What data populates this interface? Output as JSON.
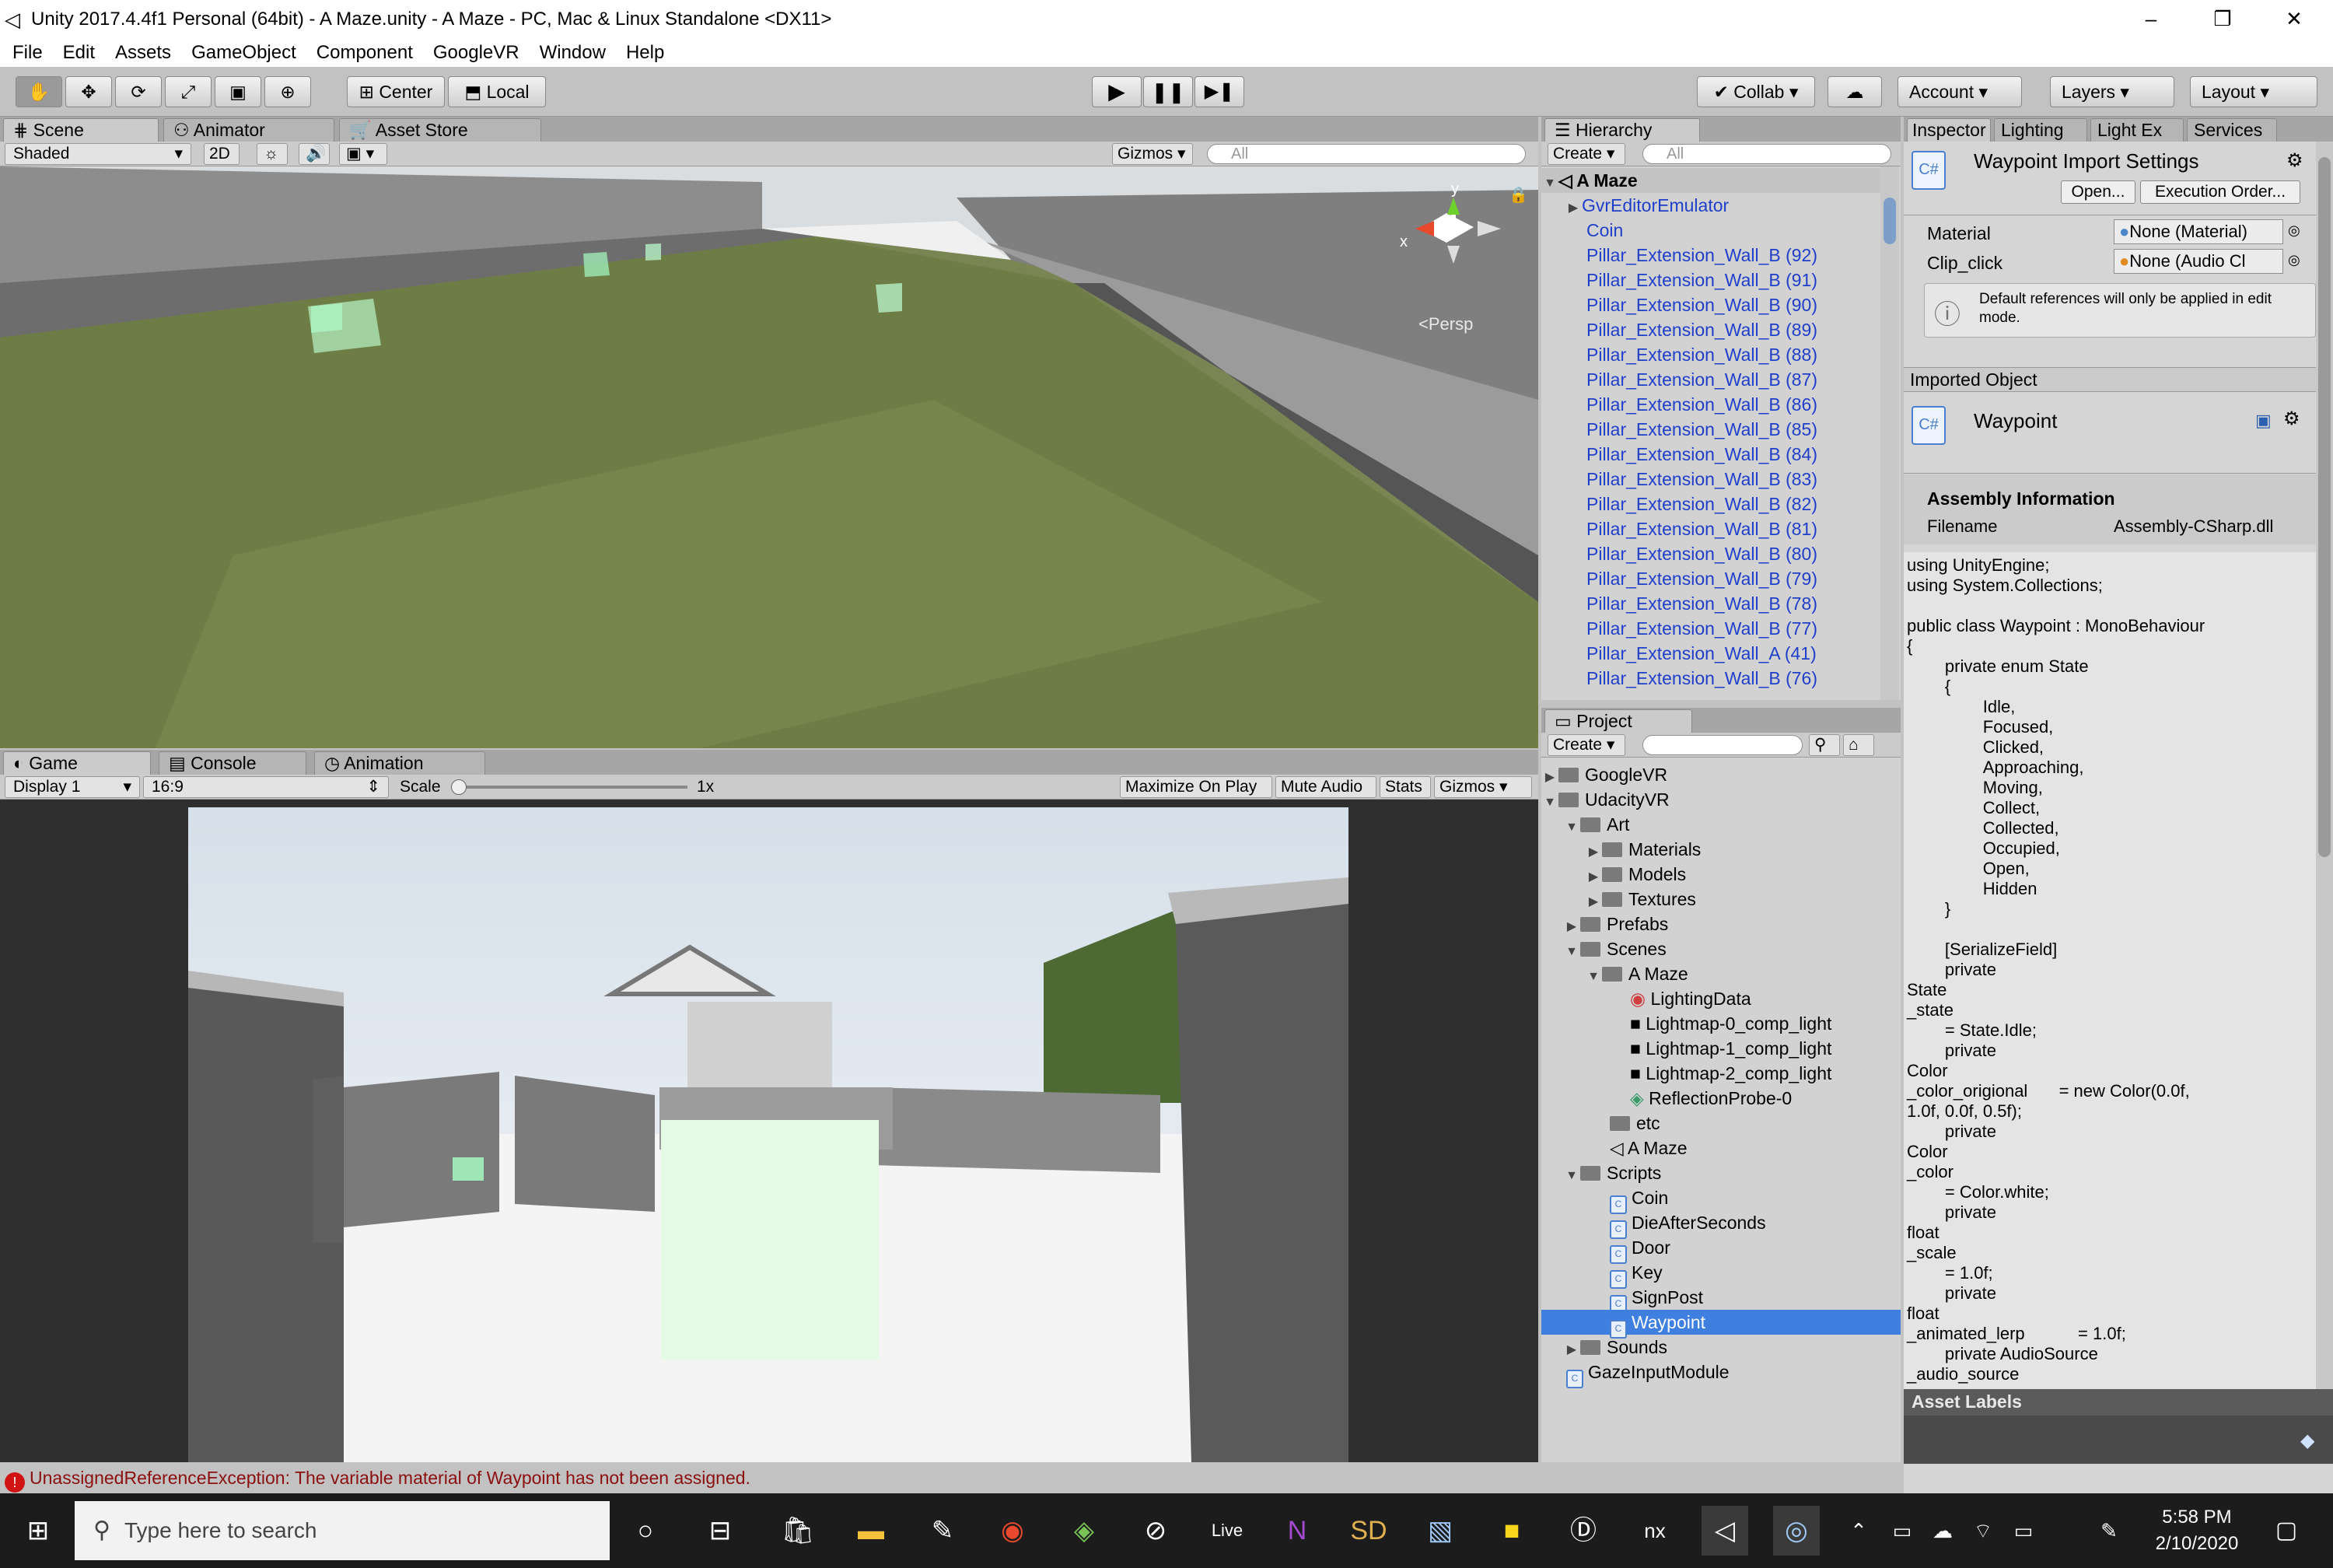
{
  "window": {
    "title": "Unity 2017.4.4f1 Personal (64bit) - A Maze.unity - A Maze - PC, Mac & Linux Standalone <DX11>",
    "controls": [
      "–",
      "❐",
      "✕"
    ]
  },
  "menu": [
    "File",
    "Edit",
    "Assets",
    "GameObject",
    "Component",
    "GoogleVR",
    "Window",
    "Help"
  ],
  "toolbar": {
    "center": "Center",
    "local": "Local",
    "collab": "Collab",
    "account": "Account",
    "layers": "Layers",
    "layout": "Layout"
  },
  "scene_panel": {
    "tabs": [
      "Scene",
      "Animator",
      "Asset Store"
    ],
    "shading": "Shaded",
    "mode2d": "2D",
    "gizmos": "Gizmos",
    "search": "All",
    "persp": "Persp",
    "axis_y": "y",
    "axis_x": "x"
  },
  "game_panel": {
    "tabs": [
      "Game",
      "Console",
      "Animation"
    ],
    "display": "Display 1",
    "aspect": "16:9",
    "scale_label": "Scale",
    "scale_value": "1x",
    "maximize": "Maximize On Play",
    "mute": "Mute Audio",
    "stats": "Stats",
    "gizmos": "Gizmos"
  },
  "hierarchy": {
    "tab": "Hierarchy",
    "create": "Create",
    "search": "All",
    "scene": "A Maze",
    "items": [
      "GvrEditorEmulator",
      "Coin",
      "Pillar_Extension_Wall_B (92)",
      "Pillar_Extension_Wall_B (91)",
      "Pillar_Extension_Wall_B (90)",
      "Pillar_Extension_Wall_B (89)",
      "Pillar_Extension_Wall_B (88)",
      "Pillar_Extension_Wall_B (87)",
      "Pillar_Extension_Wall_B (86)",
      "Pillar_Extension_Wall_B (85)",
      "Pillar_Extension_Wall_B (84)",
      "Pillar_Extension_Wall_B (83)",
      "Pillar_Extension_Wall_B (82)",
      "Pillar_Extension_Wall_B (81)",
      "Pillar_Extension_Wall_B (80)",
      "Pillar_Extension_Wall_B (79)",
      "Pillar_Extension_Wall_B (78)",
      "Pillar_Extension_Wall_B (77)",
      "Pillar_Extension_Wall_A (41)",
      "Pillar_Extension_Wall_B (76)"
    ]
  },
  "project": {
    "tab": "Project",
    "create": "Create",
    "items": [
      "GoogleVR",
      "UdacityVR",
      "Art",
      "Materials",
      "Models",
      "Textures",
      "Prefabs",
      "Scenes",
      "A Maze",
      "LightingData",
      "Lightmap-0_comp_light",
      "Lightmap-1_comp_light",
      "Lightmap-2_comp_light",
      "ReflectionProbe-0",
      "etc",
      "A Maze",
      "Scripts",
      "Coin",
      "DieAfterSeconds",
      "Door",
      "Key",
      "SignPost",
      "Waypoint",
      "Sounds",
      "GazeInputModule"
    ]
  },
  "inspector": {
    "tabs": [
      "Inspector",
      "Lighting",
      "Light Ex",
      "Services"
    ],
    "title": "Waypoint Import Settings",
    "open": "Open...",
    "exec_order": "Execution Order...",
    "material_label": "Material",
    "material_value": "None (Material)",
    "clip_label": "Clip_click",
    "clip_value": "None (Audio Cl",
    "note": "Default references will only be applied in edit mode.",
    "imported_object": "Imported Object",
    "object_name": "Waypoint",
    "assembly_info": "Assembly Information",
    "filename_label": "Filename",
    "filename_value": "Assembly-CSharp.dll",
    "code": "using UnityEngine;\nusing System.Collections;\n\npublic class Waypoint : MonoBehaviour\n{\n\t\tprivate enum State\n\t\t{\n\t\t\t\tIdle,\n\t\t\t\tFocused,\n\t\t\t\tClicked,\n\t\t\t\tApproaching,\n\t\t\t\tMoving,\n\t\t\t\tCollect,\n\t\t\t\tCollected,\n\t\t\t\tOccupied,\n\t\t\t\tOpen,\n\t\t\t\tHidden\n\t\t}\n\n\t\t[SerializeField]\n\t\tprivate\nState\n_state\n\t\t= State.Idle;\n\t\tprivate\nColor\n_color_origional\t\t= new Color(0.0f,\n1.0f, 0.0f, 0.5f);\n\t\tprivate\nColor\n_color\n\t\t= Color.white;\n\t\tprivate\nfloat\n_scale\n\t\t= 1.0f;\n\t\tprivate\nfloat\n_animated_lerp\t\t\t= 1.0f;\n\t\tprivate AudioSource\n_audio_source",
    "asset_labels": "Asset Labels"
  },
  "status": {
    "error": "UnassignedReferenceException: The variable material of Waypoint has not been assigned."
  },
  "taskbar": {
    "search": "Type here to search",
    "time": "5:58 PM",
    "date": "2/10/2020"
  }
}
